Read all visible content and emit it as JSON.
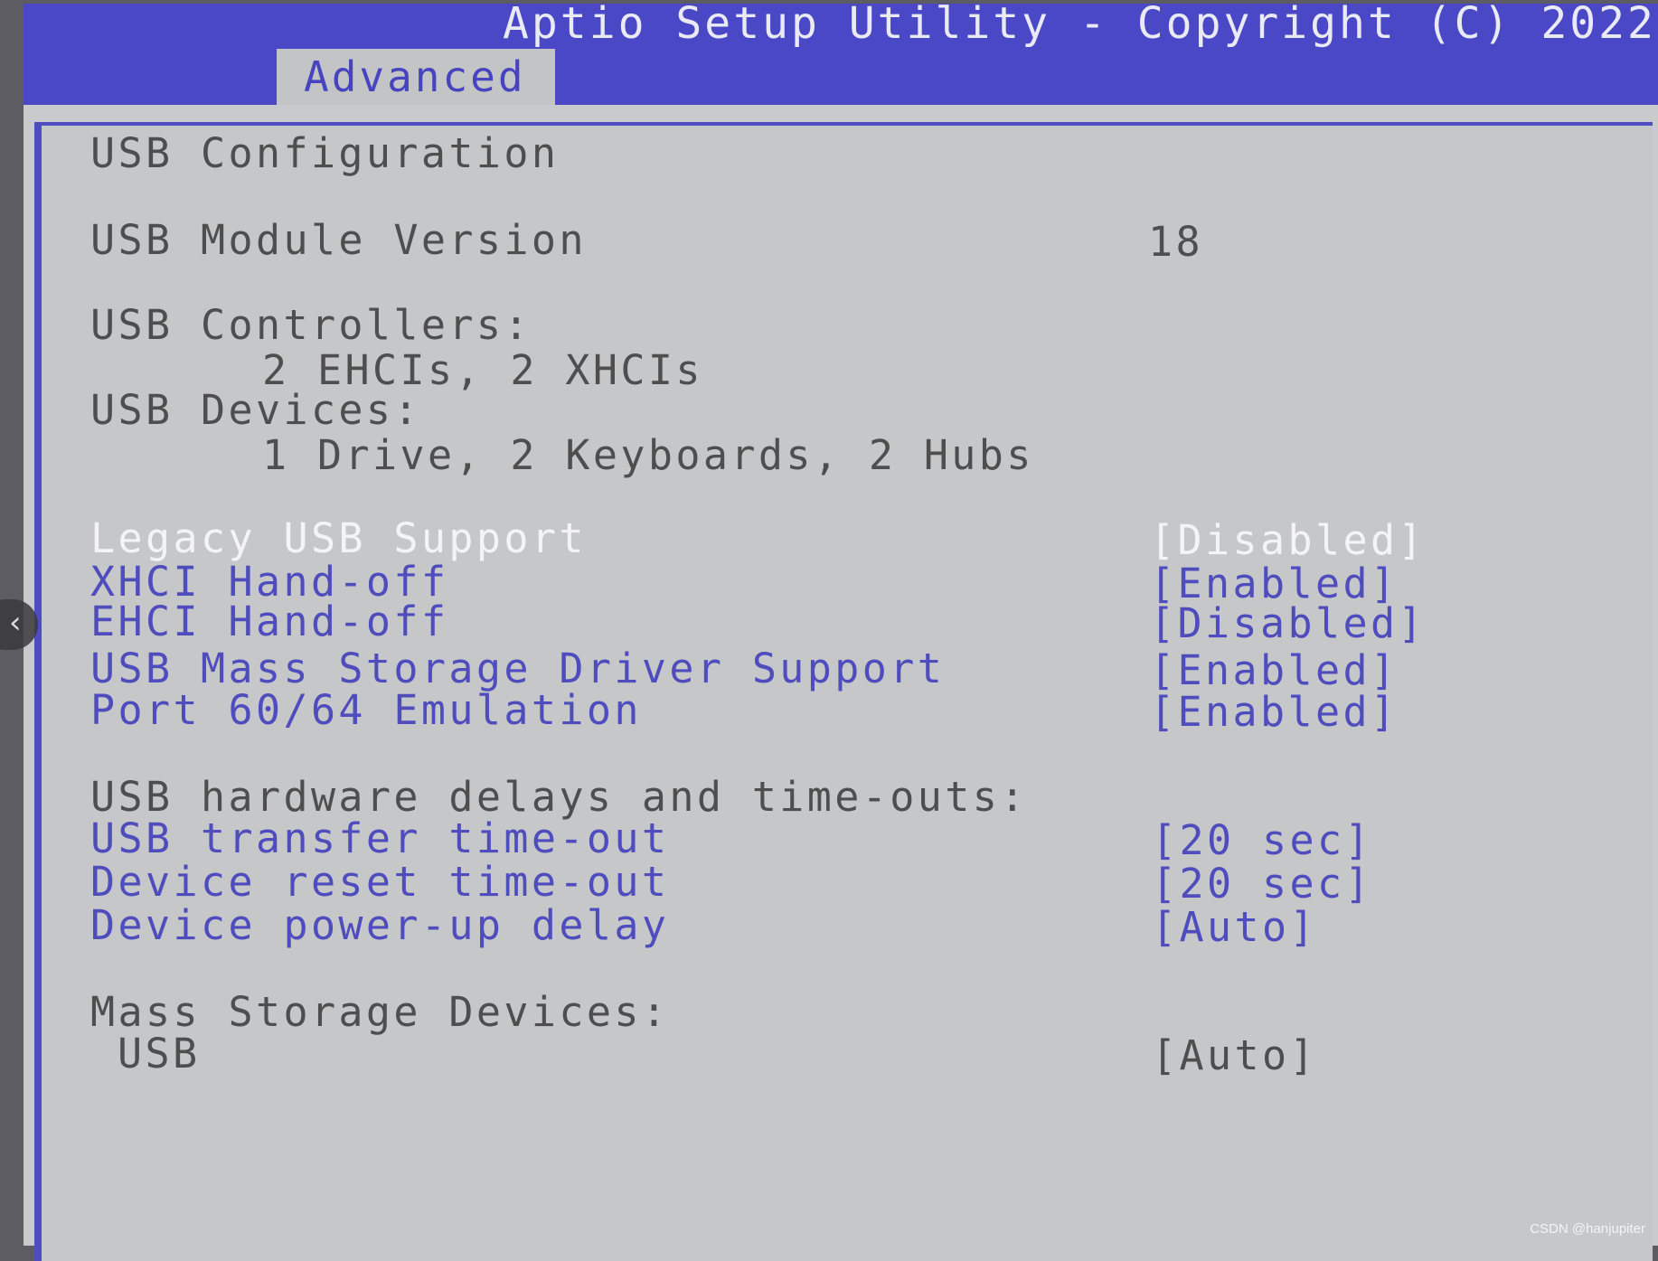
{
  "title": "Aptio Setup Utility - Copyright (C) 2022 ",
  "tab": "Advanced",
  "section_title": "USB Configuration",
  "module_version": {
    "label": "USB Module Version",
    "value": "18"
  },
  "controllers": {
    "label": "USB Controllers:",
    "value": "2 EHCIs, 2 XHCIs"
  },
  "devices": {
    "label": "USB Devices:",
    "value": "1 Drive, 2 Keyboards, 2 Hubs"
  },
  "options": [
    {
      "label": "Legacy USB Support",
      "value": "[Disabled]",
      "selected": true
    },
    {
      "label": "XHCI Hand-off",
      "value": "[Enabled]"
    },
    {
      "label": "EHCI Hand-off",
      "value": "[Disabled]"
    },
    {
      "label": "USB Mass Storage Driver Support",
      "value": "[Enabled]"
    },
    {
      "label": "Port 60/64 Emulation",
      "value": "[Enabled]"
    }
  ],
  "delays_heading": "USB hardware delays and time-outs:",
  "delay_options": [
    {
      "label": "USB transfer time-out",
      "value": "[20 sec]"
    },
    {
      "label": "Device reset time-out",
      "value": "[20 sec]"
    },
    {
      "label": "Device power-up delay",
      "value": "[Auto]"
    }
  ],
  "mass_storage_heading": "Mass Storage Devices:",
  "mass_storage_item": {
    "label": "USB",
    "value": "[Auto]"
  },
  "nav_icon": "chevron-left-icon",
  "watermark": "CSDN @hanjupiter",
  "colors": {
    "title_bar": "#4a48c6",
    "screen_bg": "#c9cacb",
    "option_text": "#4f4dbe",
    "static_text": "#4e4e4e",
    "selected_text": "#f4f4f6"
  }
}
